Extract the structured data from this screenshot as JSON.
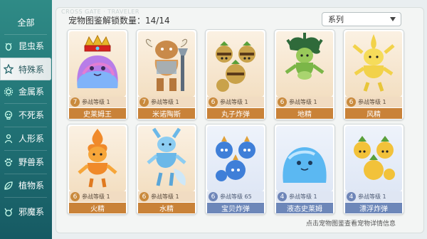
{
  "sidebar": {
    "tabs": [
      {
        "label": "全部",
        "icon": "none",
        "active": false
      },
      {
        "label": "昆虫系",
        "icon": "bug-icon",
        "active": false
      },
      {
        "label": "特殊系",
        "icon": "star-icon",
        "active": true
      },
      {
        "label": "金属系",
        "icon": "gear-icon",
        "active": false
      },
      {
        "label": "不死系",
        "icon": "skull-icon",
        "active": false
      },
      {
        "label": "人形系",
        "icon": "person-icon",
        "active": false
      },
      {
        "label": "野兽系",
        "icon": "paw-icon",
        "active": false
      },
      {
        "label": "植物系",
        "icon": "leaf-icon",
        "active": false
      },
      {
        "label": "邪魔系",
        "icon": "demon-icon",
        "active": false
      }
    ]
  },
  "header": {
    "watermark": "CROSS GATE · TRAVELER",
    "unlock_label": "宠物图鉴解锁数量：",
    "unlock_count": "14/14",
    "filter_label": "系列"
  },
  "cards": [
    {
      "name": "史莱姆王",
      "level_label": "参战等级 1",
      "number": "7",
      "style": "orange",
      "art": "crown-slime"
    },
    {
      "name": "米诺陶斯",
      "level_label": "参战等级 1",
      "number": "7",
      "style": "orange",
      "art": "minotaur"
    },
    {
      "name": "丸子炸弹",
      "level_label": "参战等级 1",
      "number": "6",
      "style": "orange",
      "art": "bombs"
    },
    {
      "name": "地精",
      "level_label": "参战等级 1",
      "number": "6",
      "style": "orange",
      "art": "earth-spirit"
    },
    {
      "name": "风精",
      "level_label": "参战等级 1",
      "number": "6",
      "style": "orange",
      "art": "wind-spirit"
    },
    {
      "name": "火精",
      "level_label": "参战等级 1",
      "number": "6",
      "style": "orange",
      "art": "fire-spirit"
    },
    {
      "name": "水精",
      "level_label": "参战等级 1",
      "number": "6",
      "style": "orange",
      "art": "water-spirit"
    },
    {
      "name": "宝贝炸弹",
      "level_label": "参战等级 65",
      "number": "6",
      "style": "blue",
      "art": "blue-bombs"
    },
    {
      "name": "液态史莱姆",
      "level_label": "参战等级 1",
      "number": "4",
      "style": "blue",
      "art": "blue-slime"
    },
    {
      "name": "漂浮炸弹",
      "level_label": "参战等级 1",
      "number": "4",
      "style": "blue",
      "art": "float-bombs"
    }
  ],
  "footer_hint": "点击宠物图鉴查看宠物详情信息",
  "colors": {
    "sidebar": "#1f6e72",
    "card_orange": "#c98238",
    "card_blue": "#6d87b9"
  }
}
